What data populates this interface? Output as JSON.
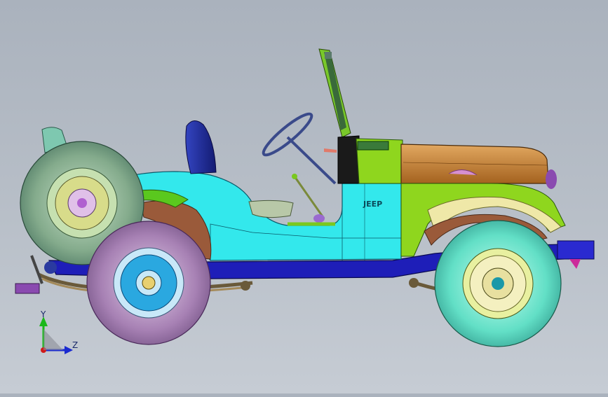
{
  "viewport": {
    "background_top": "#aab2bd",
    "background_bottom": "#c6ccd4"
  },
  "model": {
    "badge_text": "JEEP",
    "colors": {
      "body_cyan": "#2fe8ec",
      "hood_brown": "#b9742e",
      "cowl_green": "#8fd61e",
      "frame_blue": "#1a1ab4",
      "seat_blue": "#1f2fa0",
      "spare_tire": "#7ea88a",
      "rear_tire": "#a77fb3",
      "front_tire": "#5ee0c8",
      "fender_liner": "#9a5a3a"
    }
  },
  "triad": {
    "y_label": "Y",
    "z_label": "Z"
  }
}
